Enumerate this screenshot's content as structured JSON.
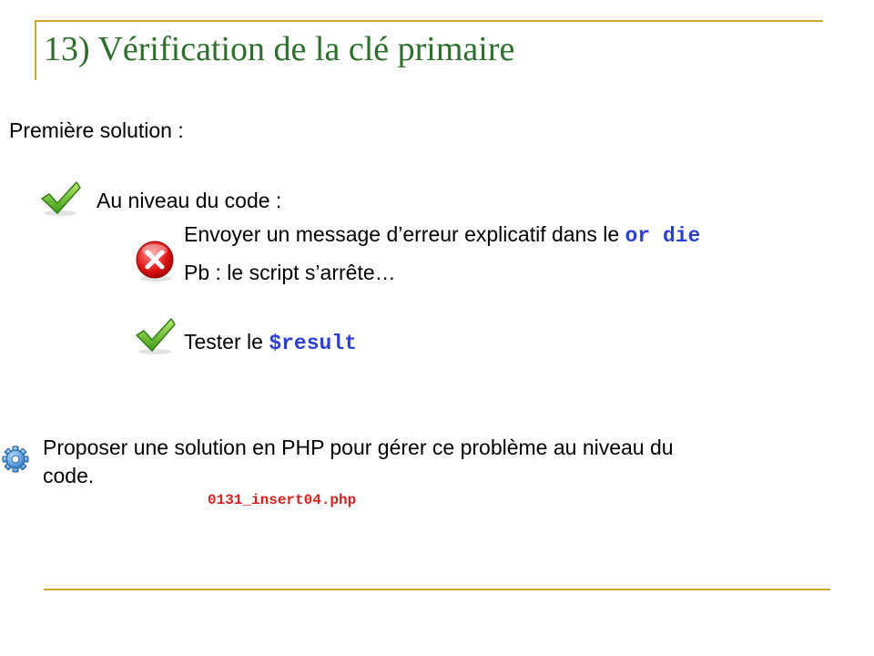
{
  "title": "13) Vérification de la clé primaire",
  "intro": "Première solution :",
  "items": {
    "code_level": "Au niveau du code :",
    "send_message": "Envoyer un message d’erreur explicatif dans le ",
    "send_message_code": "or die",
    "problem": "Pb : le script s’arrête…",
    "test": "Tester le ",
    "test_code": "$result"
  },
  "exercise": {
    "line1": "Proposer une solution en PHP pour gérer ce problème au niveau du",
    "line2": "code.",
    "file": "0131_insert04.php"
  },
  "icons": [
    "check-icon",
    "cross-icon",
    "check-icon",
    "gear-icon"
  ],
  "colors": {
    "title": "#2d6e2d",
    "rule": "#c9a82a",
    "code": "#2b3fd0",
    "file": "#d6211f"
  }
}
